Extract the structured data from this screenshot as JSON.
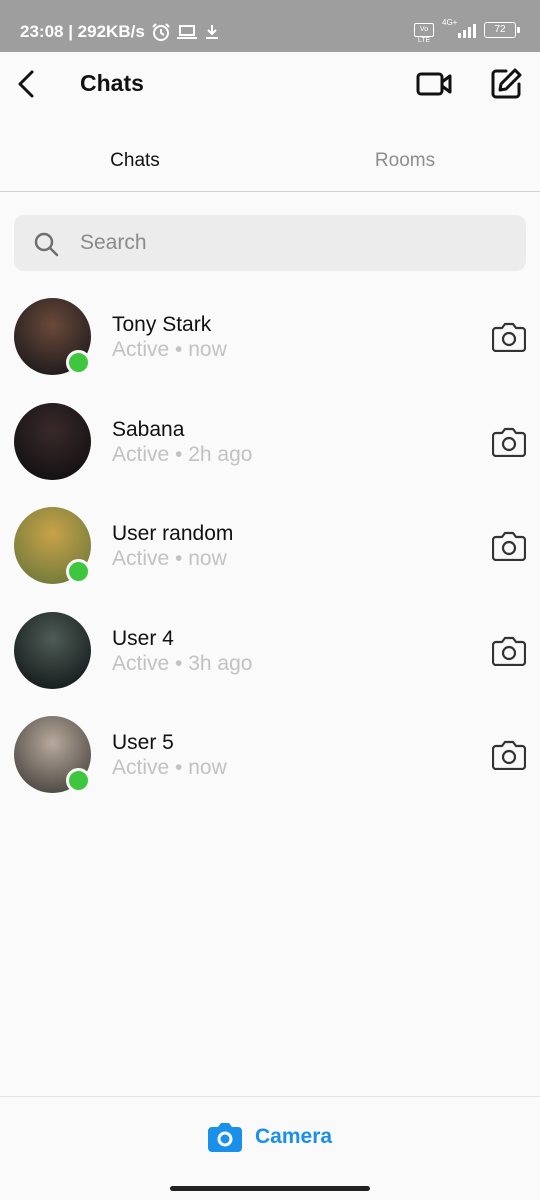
{
  "status_bar": {
    "time_and_speed": "23:08 | 292KB/s",
    "network_label": "4G+",
    "volte_label": "Vo LTE",
    "battery": "72",
    "icons": [
      "alarm-icon",
      "laptop-icon",
      "download-icon",
      "signal-icon",
      "battery-icon"
    ]
  },
  "header": {
    "title": "Chats",
    "icons": [
      "back-arrow-icon",
      "video-camera-icon",
      "compose-icon"
    ]
  },
  "tabs": [
    {
      "label": "Chats",
      "selected": true
    },
    {
      "label": "Rooms",
      "selected": false
    }
  ],
  "search": {
    "placeholder": "Search",
    "value": ""
  },
  "chats": [
    {
      "name": "Tony Stark",
      "status": "Active • now",
      "online": true,
      "avatar_colors": [
        "#6b4a3a",
        "#1d1a1c"
      ]
    },
    {
      "name": "Sabana",
      "status": "Active • 2h ago",
      "online": false,
      "avatar_colors": [
        "#3a2a2a",
        "#121012"
      ]
    },
    {
      "name": "User random",
      "status": "Active • now",
      "online": true,
      "avatar_colors": [
        "#c9a24a",
        "#6f7a3a"
      ]
    },
    {
      "name": "User 4",
      "status": "Active • 3h ago",
      "online": false,
      "avatar_colors": [
        "#4f5c56",
        "#141b1b"
      ]
    },
    {
      "name": "User 5",
      "status": "Active • now",
      "online": true,
      "avatar_colors": [
        "#b7a99c",
        "#4a4540"
      ]
    }
  ],
  "bottom_bar": {
    "camera_label": "Camera"
  },
  "colors": {
    "accent": "#1a90e8",
    "online": "#3ec73e",
    "muted_text": "#c2c2c2",
    "status_bar": "#9e9e9e"
  }
}
